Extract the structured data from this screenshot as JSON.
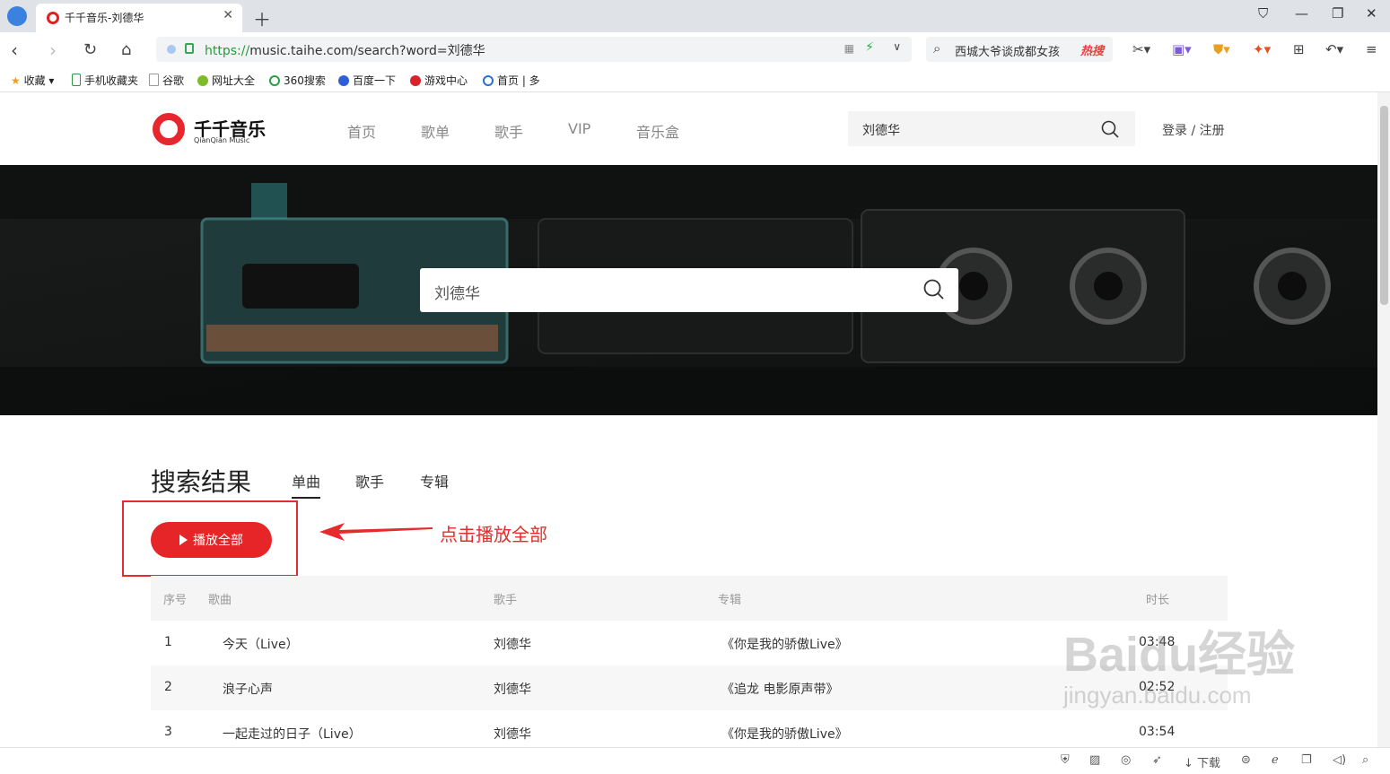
{
  "browser": {
    "tab_title": "千千音乐-刘德华",
    "url_scheme": "https://",
    "url_rest": "music.taihe.com/search?word=刘德华",
    "search_suggestion": "西城大爷谈成都女孩",
    "hot_label": "热搜",
    "bookmarks": [
      "收藏",
      "手机收藏夹",
      "谷歌",
      "网址大全",
      "360搜索",
      "百度一下",
      "游戏中心",
      "首页 | 多"
    ],
    "status_download": "下载"
  },
  "site": {
    "logo_name": "千千音乐",
    "logo_sub": "QianQian Music",
    "nav": [
      "首页",
      "歌单",
      "歌手",
      "VIP",
      "音乐盒"
    ],
    "header_search_value": "刘德华",
    "login_label": "登录 / 注册",
    "banner_search_value": "刘德华"
  },
  "results": {
    "title": "搜索结果",
    "tabs": [
      "单曲",
      "歌手",
      "专辑"
    ],
    "play_all_label": "播放全部",
    "annotation": "点击播放全部",
    "columns": [
      "序号",
      "歌曲",
      "歌手",
      "专辑",
      "时长"
    ],
    "rows": [
      {
        "index": "1",
        "song": "今天（Live）",
        "artist": "刘德华",
        "album": "《你是我的骄傲Live》",
        "duration": "03:48"
      },
      {
        "index": "2",
        "song": "浪子心声",
        "artist": "刘德华",
        "album": "《追龙 电影原声带》",
        "duration": "02:52"
      },
      {
        "index": "3",
        "song": "一起走过的日子（Live）",
        "artist": "刘德华",
        "album": "《你是我的骄傲Live》",
        "duration": "03:54"
      }
    ]
  },
  "watermark": {
    "brand": "Baidu",
    "suffix": "经验",
    "url": "jingyan.baidu.com"
  },
  "colors": {
    "brand_red": "#e52527",
    "annotation_red": "#e52b2b",
    "url_green": "#2b9a3d"
  }
}
